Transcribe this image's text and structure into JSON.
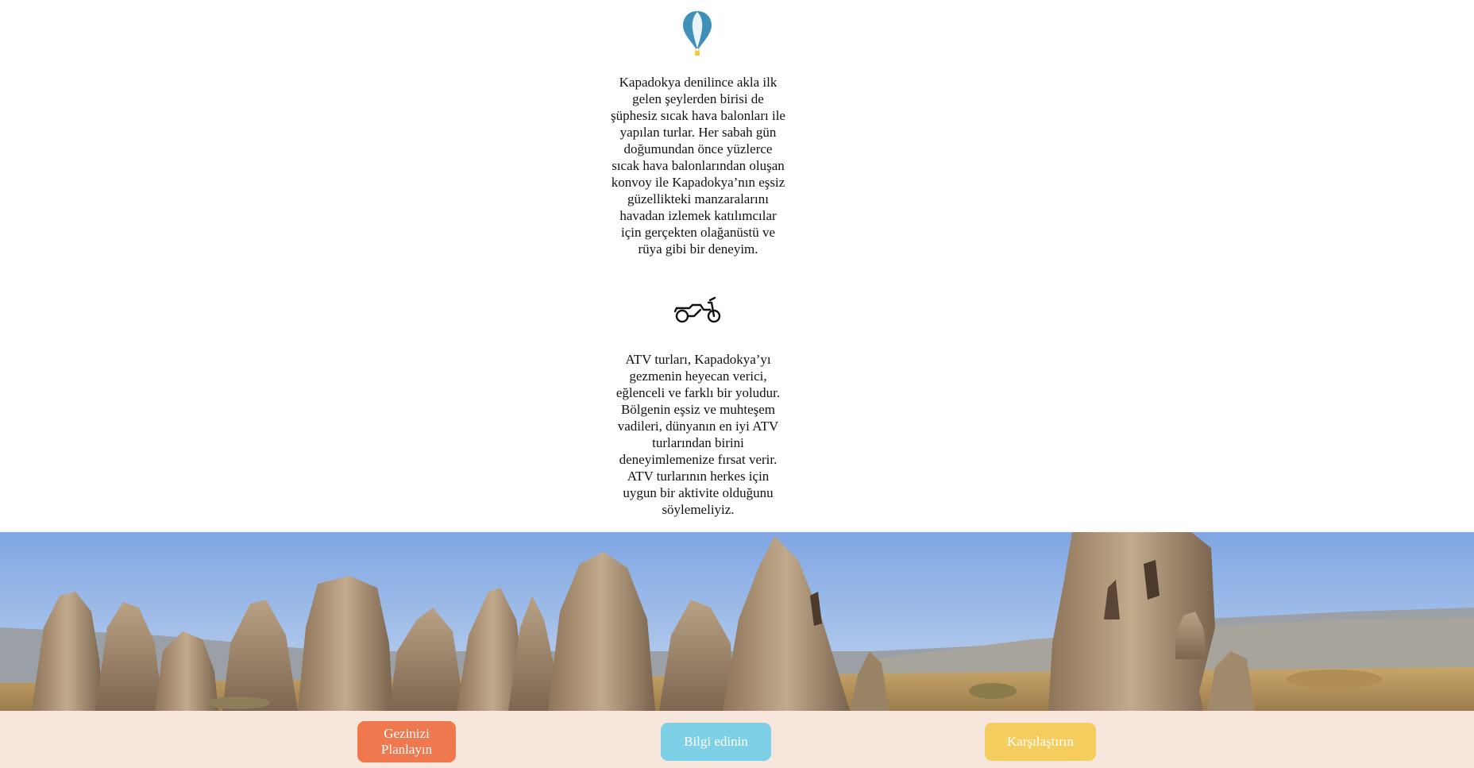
{
  "icons": {
    "balloon": "hot-air-balloon-icon",
    "atv": "atv-motorbike-icon"
  },
  "sections": [
    {
      "text": "Kapadokya denilince akla ilk gelen şeylerden birisi de şüphesiz sıcak hava balonları ile yapılan turlar. Her sabah gün doğumundan önce yüzlerce sıcak hava balonlarından oluşan konvoy ile Kapadokya’nın eşsiz güzellikteki manzaralarını havadan izlemek katılımcılar için gerçekten olağanüstü ve rüya gibi bir deneyim."
    },
    {
      "text": "ATV turları, Kapadokya’yı gezmenin heyecan verici, eğlenceli ve farklı bir yoludur. Bölgenin eşsiz ve muhteşem vadileri, dünyanın en iyi ATV turlarından birini deneyimlemenize fırsat verir. ATV turlarının herkes için uygun bir aktivite olduğunu söylemeliyiz."
    }
  ],
  "footer": {
    "buttons": [
      {
        "label": "Gezinizi Planlayın",
        "color": "#f0784f"
      },
      {
        "label": "Bilgi edinin",
        "color": "#7ed0e6"
      },
      {
        "label": "Karşılaştırın",
        "color": "#f5cd5f"
      }
    ],
    "background": "#f6e6dc"
  },
  "colors": {
    "balloon_blue": "#3f8fb8",
    "balloon_basket": "#f0c83a",
    "sky": "#8fb3e6"
  }
}
